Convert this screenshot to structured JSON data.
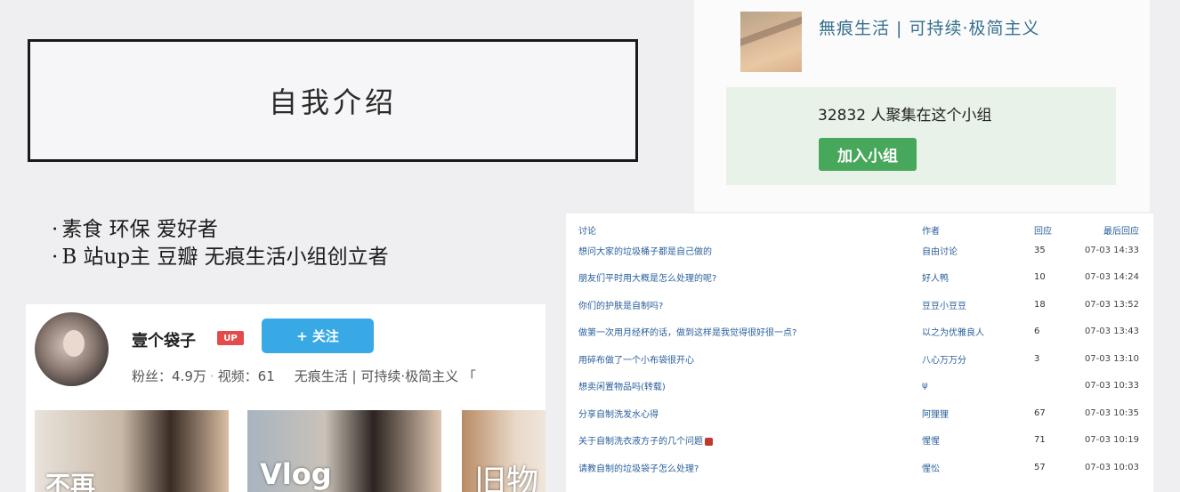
{
  "intro": {
    "title": "自我介绍",
    "bullets": [
      "素食 环保 爱好者",
      "B 站up主 豆瓣 无痕生活小组创立者"
    ]
  },
  "group": {
    "name": "無痕生活 | 可持续·极简主义",
    "member_count_text": "32832 人聚集在这个小组",
    "join_label": "加入小组",
    "accent": "#47a75a",
    "link_color": "#37708f"
  },
  "profile": {
    "username": "壹个袋子",
    "badge": "UP",
    "follow_label": "+ 关注",
    "fans_label": "粉丝：",
    "fans_value": "4.9万",
    "videos_label": "视频：",
    "videos_value": "61",
    "tagline": "无痕生活 | 可持续·极简主义 「",
    "follow_color": "#39a9e6",
    "thumbnails": [
      {
        "caption": "不再"
      },
      {
        "caption": "Vlog"
      },
      {
        "caption": "旧物"
      }
    ]
  },
  "topics": {
    "headers": {
      "title": "讨论",
      "author": "作者",
      "replies": "回应",
      "last": "最后回应"
    },
    "rows": [
      {
        "title": "想问大家的垃圾桶子都是自己做的",
        "author": "自由讨论",
        "replies": "35",
        "time": "07-03 14:33"
      },
      {
        "title": "朋友们平时用大概是怎么处理的呢?",
        "author": "好人鸭",
        "replies": "10",
        "time": "07-03 14:24"
      },
      {
        "title": "你们的护肤是自制吗?",
        "author": "豆豆小豆豆",
        "replies": "18",
        "time": "07-03 13:52"
      },
      {
        "title": "做第一次用月经杯的话，做到这样是我觉得很好很一点?",
        "author": "以之为优雅良人",
        "replies": "6",
        "time": "07-03 13:43"
      },
      {
        "title": "用碎布做了一个小布袋很开心",
        "author": "八心万万分",
        "replies": "3",
        "time": "07-03 13:10"
      },
      {
        "title": "想卖闲置物品吗(转载)",
        "author": "ψ",
        "replies": "",
        "time": "07-03 10:33"
      },
      {
        "title": "分享自制洗发水心得",
        "author": "阿狸狸",
        "replies": "67",
        "time": "07-03 10:35"
      },
      {
        "title": "关于自制洗衣液方子的几个问题",
        "author": "惺惺",
        "replies": "71",
        "time": "07-03 10:19",
        "hot": true
      },
      {
        "title": "请教自制的垃圾袋子怎么处理?",
        "author": "惺忪",
        "replies": "57",
        "time": "07-03 10:03"
      }
    ]
  }
}
